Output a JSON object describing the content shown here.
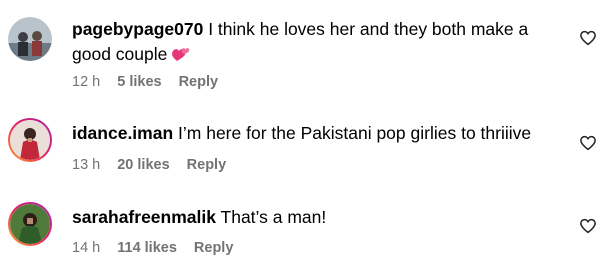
{
  "comments": [
    {
      "username": "pagebypage070",
      "text": "I think he loves her and they both make a",
      "text2": "good couple",
      "emoji": "two-hearts",
      "time": "12 h",
      "likes": "5 likes",
      "reply": "Reply"
    },
    {
      "username": "idance.iman",
      "text": "I’m here for the Pakistani pop girlies to thriiive",
      "time": "13 h",
      "likes": "20 likes",
      "reply": "Reply"
    },
    {
      "username": "sarahafreenmalik",
      "text": "That’s a man!",
      "time": "14 h",
      "likes": "114 likes",
      "reply": "Reply"
    }
  ],
  "icons": {
    "like": "heart-outline-icon"
  },
  "colors": {
    "meta": "#737373",
    "text": "#000000",
    "emoji": "#e8367a"
  }
}
